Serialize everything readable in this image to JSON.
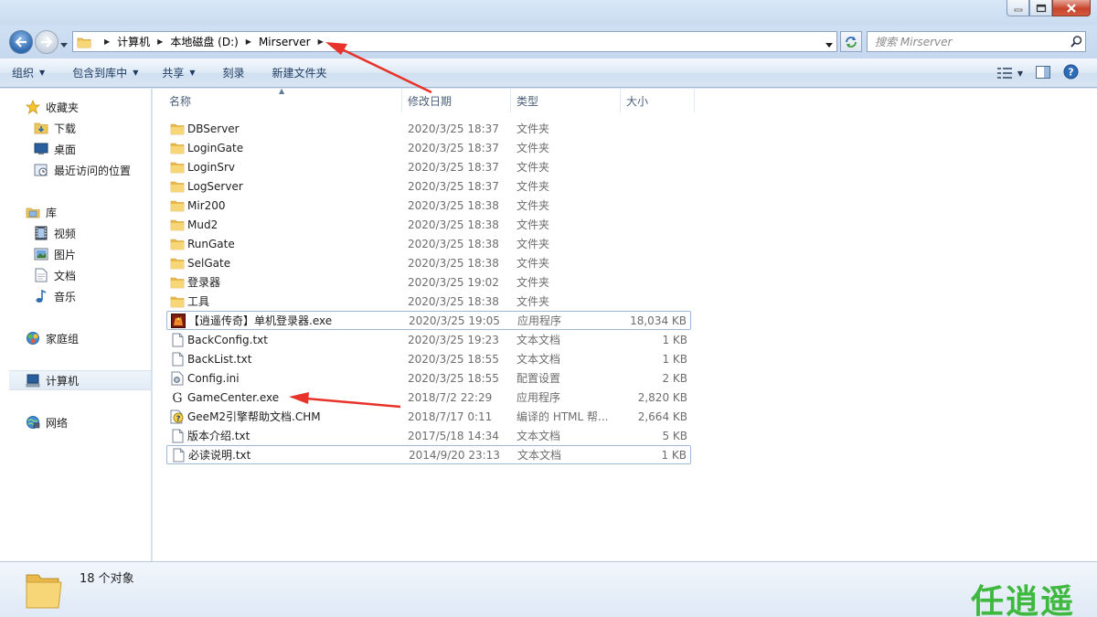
{
  "window": {
    "buttons": [
      "minimize",
      "maximize",
      "close"
    ]
  },
  "address": {
    "breadcrumbs": [
      "计算机",
      "本地磁盘 (D:)",
      "Mirserver"
    ],
    "search_placeholder": "搜索 Mirserver"
  },
  "toolbar": {
    "items": [
      "组织",
      "包含到库中",
      "共享",
      "刻录",
      "新建文件夹"
    ]
  },
  "nav": {
    "favorites_label": "收藏夹",
    "downloads_label": "下载",
    "desktop_label": "桌面",
    "recent_label": "最近访问的位置",
    "libraries_label": "库",
    "videos_label": "视频",
    "pictures_label": "图片",
    "documents_label": "文档",
    "music_label": "音乐",
    "homegroup_label": "家庭组",
    "computer_label": "计算机",
    "network_label": "网络"
  },
  "columns": {
    "name": "名称",
    "date": "修改日期",
    "type": "类型",
    "size": "大小"
  },
  "files": [
    {
      "name": "DBServer",
      "date": "2020/3/25 18:37",
      "type": "文件夹",
      "size": "",
      "icon": "folder-icon"
    },
    {
      "name": "LoginGate",
      "date": "2020/3/25 18:37",
      "type": "文件夹",
      "size": "",
      "icon": "folder-icon"
    },
    {
      "name": "LoginSrv",
      "date": "2020/3/25 18:37",
      "type": "文件夹",
      "size": "",
      "icon": "folder-icon"
    },
    {
      "name": "LogServer",
      "date": "2020/3/25 18:37",
      "type": "文件夹",
      "size": "",
      "icon": "folder-icon"
    },
    {
      "name": "Mir200",
      "date": "2020/3/25 18:38",
      "type": "文件夹",
      "size": "",
      "icon": "folder-icon"
    },
    {
      "name": "Mud2",
      "date": "2020/3/25 18:38",
      "type": "文件夹",
      "size": "",
      "icon": "folder-icon"
    },
    {
      "name": "RunGate",
      "date": "2020/3/25 18:38",
      "type": "文件夹",
      "size": "",
      "icon": "folder-icon"
    },
    {
      "name": "SelGate",
      "date": "2020/3/25 18:38",
      "type": "文件夹",
      "size": "",
      "icon": "folder-icon"
    },
    {
      "name": "登录器",
      "date": "2020/3/25 19:02",
      "type": "文件夹",
      "size": "",
      "icon": "folder-icon"
    },
    {
      "name": "工具",
      "date": "2020/3/25 18:38",
      "type": "文件夹",
      "size": "",
      "icon": "folder-icon"
    },
    {
      "name": "【逍遥传奇】单机登录器.exe",
      "date": "2020/3/25 19:05",
      "type": "应用程序",
      "size": "18,034 KB",
      "icon": "game-app-icon"
    },
    {
      "name": "BackConfig.txt",
      "date": "2020/3/25 19:23",
      "type": "文本文档",
      "size": "1 KB",
      "icon": "text-file-icon"
    },
    {
      "name": "BackList.txt",
      "date": "2020/3/25 18:55",
      "type": "文本文档",
      "size": "1 KB",
      "icon": "text-file-icon"
    },
    {
      "name": "Config.ini",
      "date": "2020/3/25 18:55",
      "type": "配置设置",
      "size": "2 KB",
      "icon": "config-file-icon"
    },
    {
      "name": "GameCenter.exe",
      "date": "2018/7/2 22:29",
      "type": "应用程序",
      "size": "2,820 KB",
      "icon": "gamecenter-app-icon"
    },
    {
      "name": "GeeM2引擎帮助文档.CHM",
      "date": "2018/7/17 0:11",
      "type": "编译的 HTML 帮...",
      "size": "2,664 KB",
      "icon": "help-file-icon"
    },
    {
      "name": "版本介绍.txt",
      "date": "2017/5/18 14:34",
      "type": "文本文档",
      "size": "5 KB",
      "icon": "text-file-icon"
    },
    {
      "name": "必读说明.txt",
      "date": "2014/9/20 23:13",
      "type": "文本文档",
      "size": "1 KB",
      "icon": "text-file-icon"
    }
  ],
  "status": {
    "count": "18 个对象"
  },
  "watermark": "任逍遥",
  "colors": {
    "annotation_arrow": "#e8332a",
    "watermark": "#3fb83f"
  }
}
